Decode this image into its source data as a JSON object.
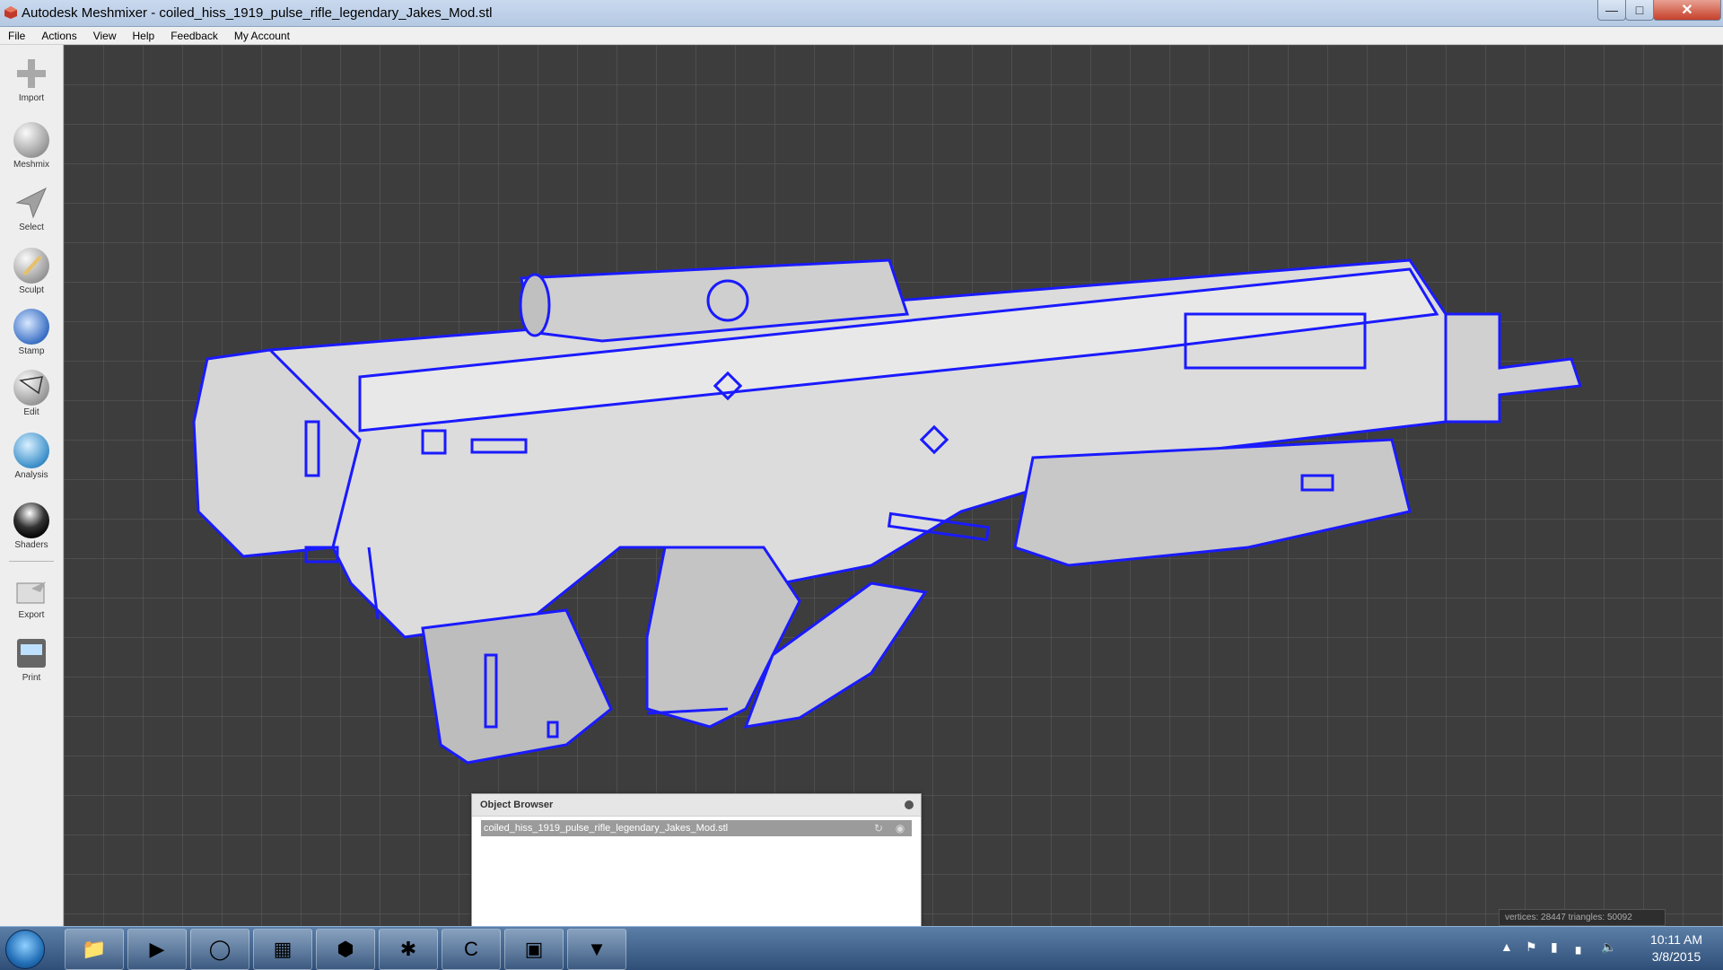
{
  "window": {
    "title": "Autodesk Meshmixer - coiled_hiss_1919_pulse_rifle_legendary_Jakes_Mod.stl",
    "minimize_icon": "minimize-icon",
    "maximize_icon": "maximize-icon",
    "close_icon": "close-icon"
  },
  "menu": [
    "File",
    "Actions",
    "View",
    "Help",
    "Feedback",
    "My Account"
  ],
  "toolbar": {
    "tools": [
      {
        "label": "Import",
        "icon": "plus-icon"
      },
      {
        "label": "Meshmix",
        "icon": "meshmix-head-icon"
      },
      {
        "label": "Select",
        "icon": "select-arrow-icon"
      },
      {
        "label": "Sculpt",
        "icon": "sculpt-brush-icon"
      },
      {
        "label": "Stamp",
        "icon": "stamp-icon"
      },
      {
        "label": "Edit",
        "icon": "edit-icon"
      },
      {
        "label": "Analysis",
        "icon": "analysis-sphere-icon"
      },
      {
        "label": "Shaders",
        "icon": "shader-sphere-icon"
      },
      {
        "label": "Export",
        "icon": "export-icon"
      },
      {
        "label": "Print",
        "icon": "print-icon"
      }
    ]
  },
  "object_browser": {
    "title": "Object Browser",
    "items": [
      {
        "name": "coiled_hiss_1919_pulse_rifle_legendary_Jakes_Mod.stl",
        "selected": true
      }
    ]
  },
  "status": {
    "text": "vertices: 28447 triangles: 50092"
  },
  "taskbar": {
    "apps": [
      "file-explorer-icon",
      "media-player-icon",
      "chrome-icon",
      "calculator-icon",
      "meshmixer-icon",
      "app-icon",
      "ccleaner-icon",
      "terminal-icon",
      "app-v-icon"
    ],
    "clock_time": "10:11 AM",
    "clock_date": "3/8/2015"
  },
  "colors": {
    "viewport_bg": "#3d3d3d",
    "model_fill": "#d8d8d8",
    "model_edge": "#1a1aff",
    "title_bar": "#c9d9ee"
  }
}
